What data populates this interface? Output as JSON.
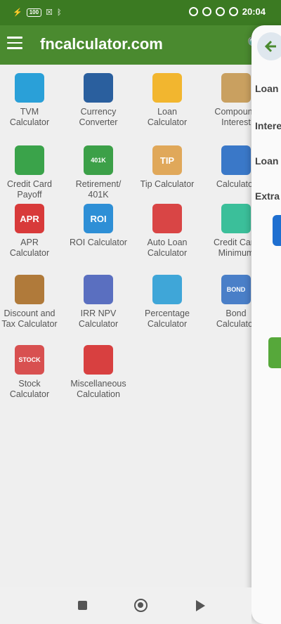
{
  "status_bar": {
    "battery": "100",
    "time": "20:04"
  },
  "app_bar": {
    "title": "fncalculator.com"
  },
  "calculators": [
    {
      "label": "TVM\nCalculator",
      "icon": "tvm-calculator-icon"
    },
    {
      "label": "Currency\nConverter",
      "icon": "currency-converter-icon"
    },
    {
      "label": "Loan\nCalculator",
      "icon": "loan-calculator-icon"
    },
    {
      "label": "Compound\nInterest",
      "icon": "compound-interest-icon"
    },
    {
      "label": "Credit Card\nPayoff",
      "icon": "credit-card-payoff-icon"
    },
    {
      "label": "Retirement/\n401K",
      "icon": "retirement-401k-icon",
      "badge": "401K"
    },
    {
      "label": "Tip Calculator",
      "icon": "tip-calculator-icon",
      "badge": "TIP"
    },
    {
      "label": "Calculator",
      "icon": "calculator-icon"
    },
    {
      "label": "APR\nCalculator",
      "icon": "apr-calculator-icon",
      "badge": "APR"
    },
    {
      "label": "ROI Calculator",
      "icon": "roi-calculator-icon",
      "badge": "ROI"
    },
    {
      "label": "Auto Loan\nCalculator",
      "icon": "auto-loan-calculator-icon"
    },
    {
      "label": "Credit Card\nMinimum",
      "icon": "credit-card-minimum-icon"
    },
    {
      "label": "Discount and\nTax Calculator",
      "icon": "discount-tax-calculator-icon"
    },
    {
      "label": "IRR NPV\nCalculator",
      "icon": "irr-npv-calculator-icon"
    },
    {
      "label": "Percentage\nCalculator",
      "icon": "percentage-calculator-icon"
    },
    {
      "label": "Bond\nCalculator",
      "icon": "bond-calculator-icon",
      "badge": "BOND"
    },
    {
      "label": "Stock\nCalculator",
      "icon": "stock-calculator-icon",
      "badge": "STOCK"
    },
    {
      "label": "Miscellaneous\nCalculation",
      "icon": "miscellaneous-calculation-icon"
    }
  ],
  "drawer": {
    "labels": [
      "Loan",
      "Intere",
      "Loan",
      "Extra"
    ]
  }
}
